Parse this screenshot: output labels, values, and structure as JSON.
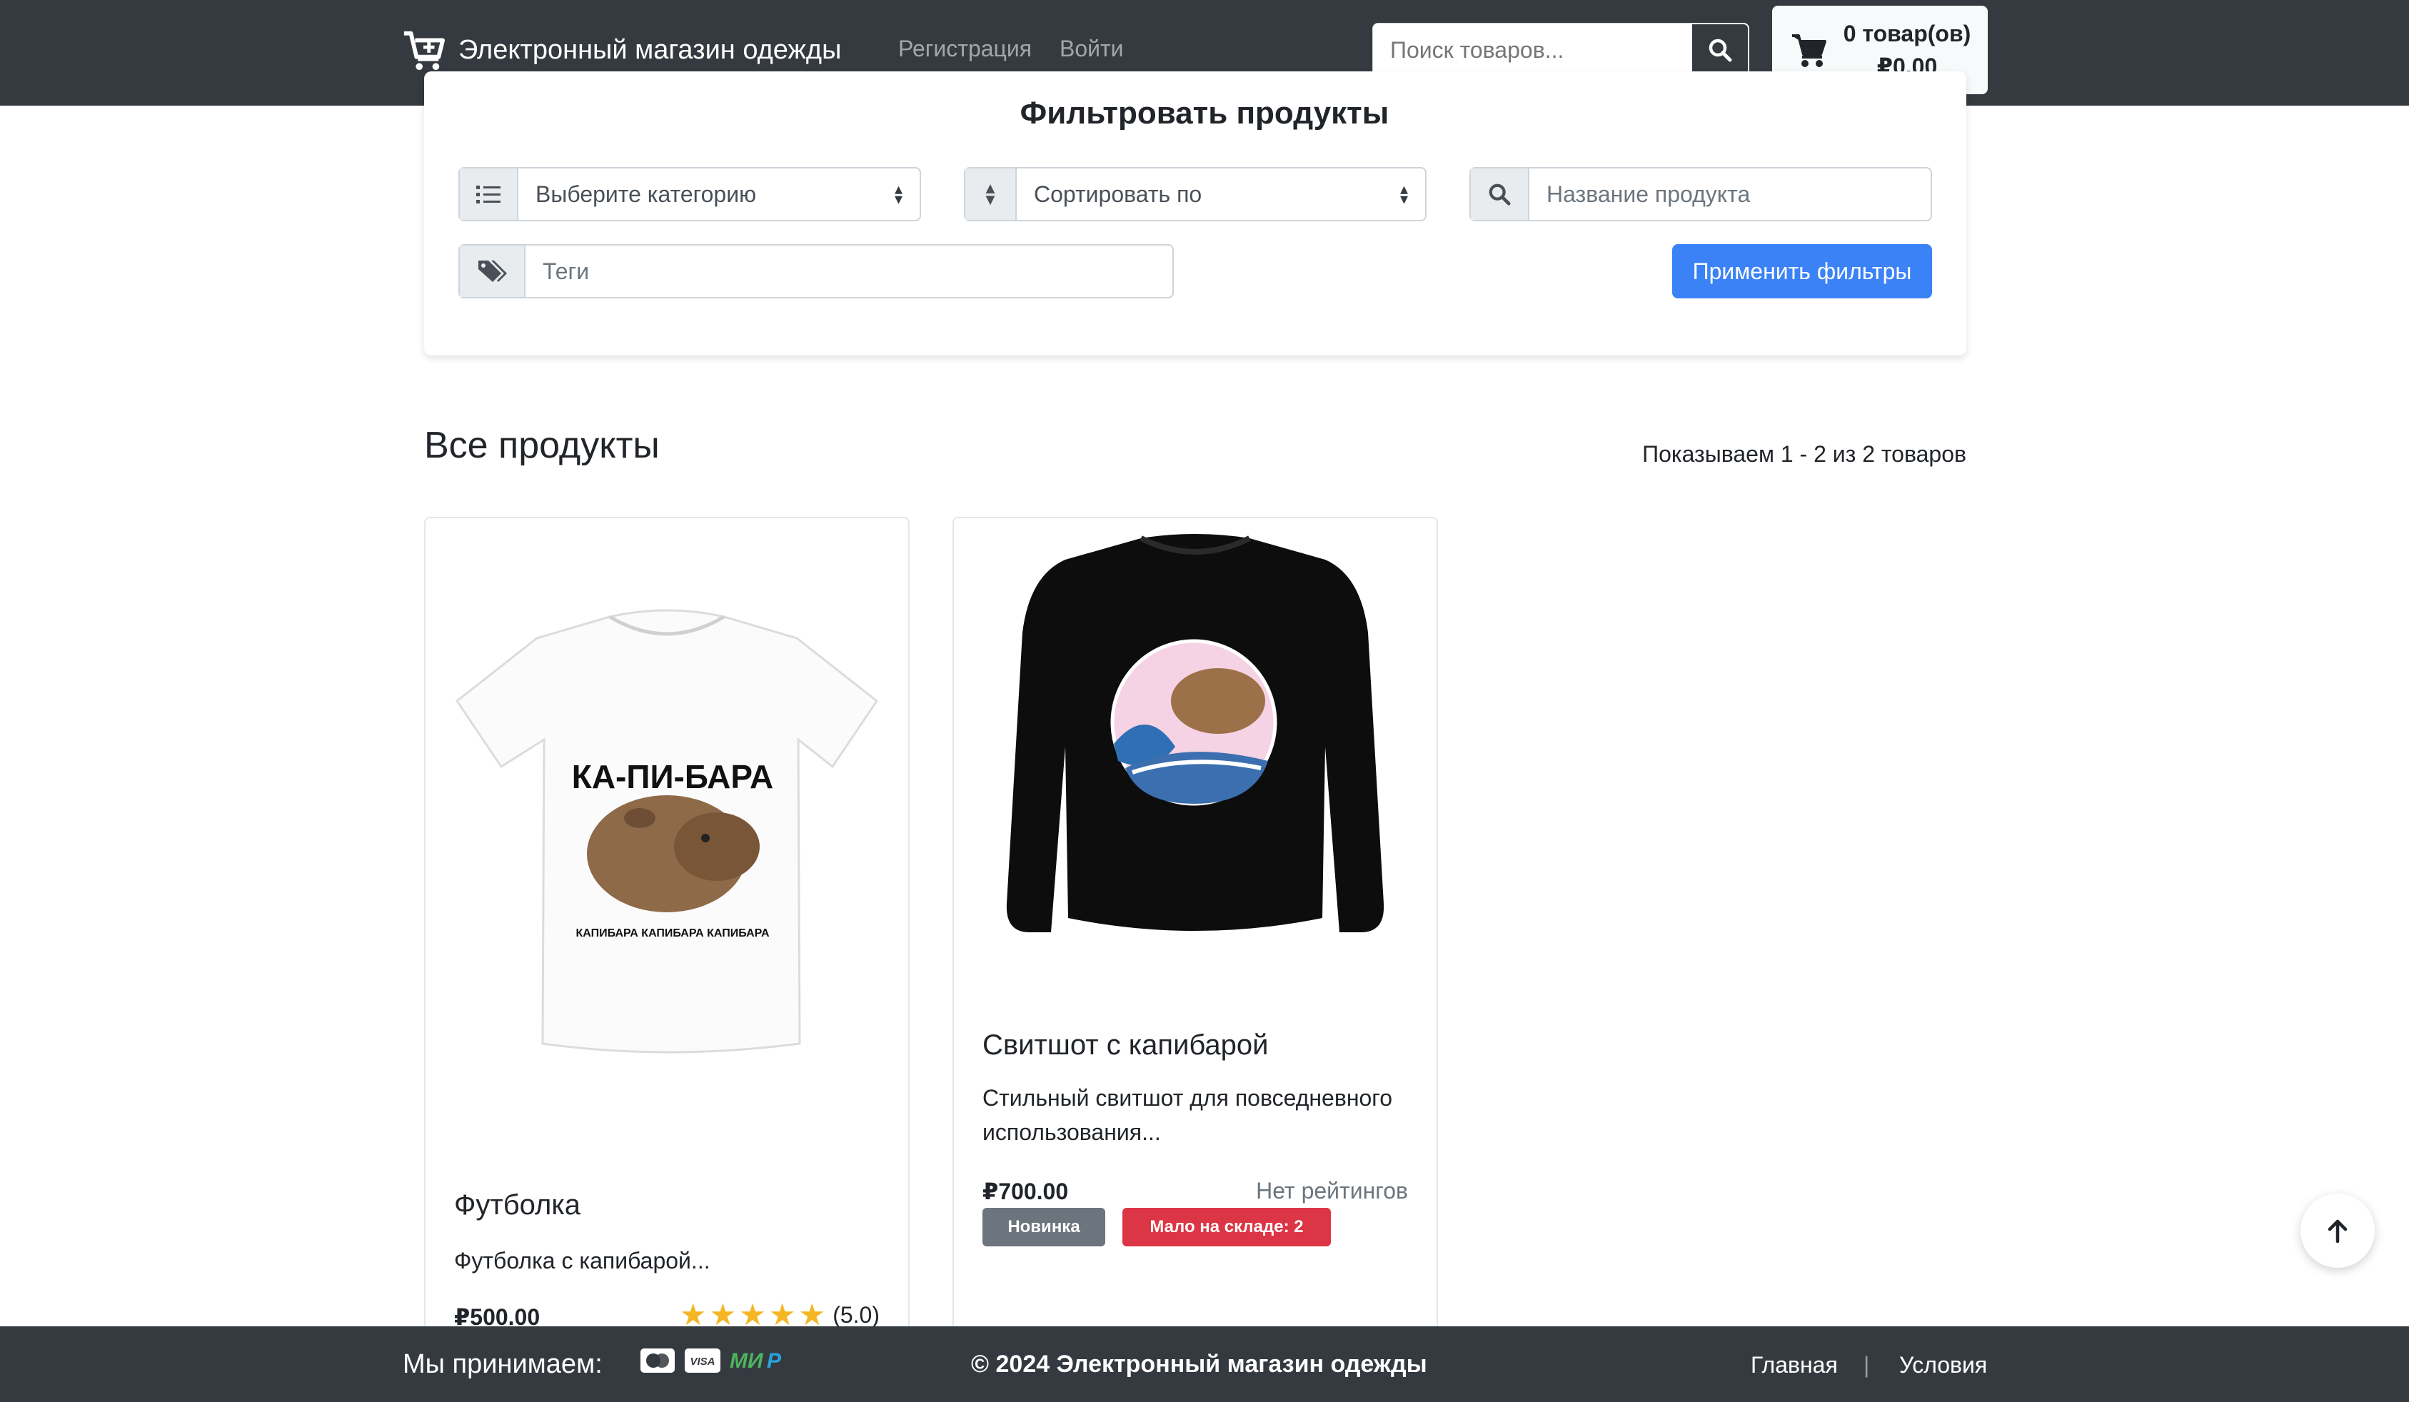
{
  "navbar": {
    "brand": "Электронный магазин одежды",
    "links": [
      "Регистрация",
      "Войти"
    ],
    "search_placeholder": "Поиск товаров...",
    "cart": {
      "count_label": "0 товар(ов)",
      "total": "₽0.00"
    }
  },
  "filters": {
    "title": "Фильтровать продукты",
    "category_placeholder": "Выберите категорию",
    "sort_placeholder": "Сортировать по",
    "name_placeholder": "Название продукта",
    "tags_placeholder": "Теги",
    "apply_label": "Применить фильтры"
  },
  "products_section": {
    "title": "Все продукты",
    "showing": "Показываем 1 - 2 из 2 товаров"
  },
  "products": [
    {
      "name": "Футболка",
      "description": "Футболка с капибарой...",
      "price": "₽500.00",
      "rating": 5,
      "rating_text": "(5.0)",
      "image_print_title": "КА-ПИ-БАРА",
      "image_print_caption": "КАПИБАРА КАПИБАРА КАПИБАРА"
    },
    {
      "name": "Свитшот с капибарой",
      "description": "Стильный свитшот для повседневного использования...",
      "price": "₽700.00",
      "rating_text": "Нет рейтингов",
      "badges": [
        "Новинка",
        "Мало на складе: 2"
      ]
    }
  ],
  "footer": {
    "accept_label": "Мы принимаем:",
    "payment_icons": [
      "mastercard-icon",
      "visa-icon",
      "mir-icon"
    ],
    "copyright": "© 2024 Электронный магазин одежды",
    "links": [
      "Главная",
      "Условия"
    ],
    "separator": "|"
  },
  "colors": {
    "navbar_bg": "#343a40",
    "primary": "#3b82f6",
    "badge_secondary": "#6c757d",
    "badge_danger": "#dc3545",
    "star": "#f4b623"
  }
}
